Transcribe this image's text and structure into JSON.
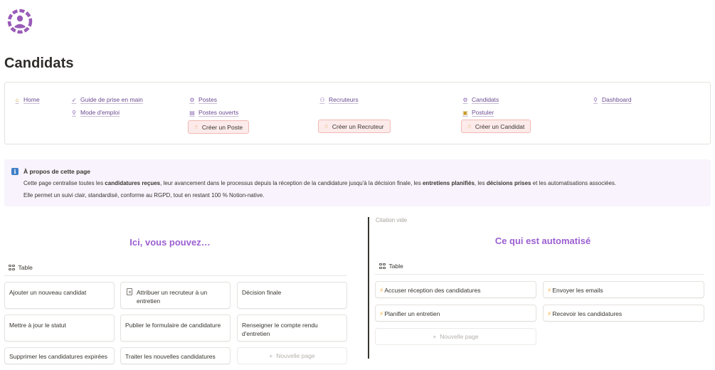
{
  "page": {
    "title": "Candidats"
  },
  "nav": {
    "home": "Home",
    "guide": "Guide de prise en main",
    "mode": "Mode d'emploi",
    "postes": "Postes",
    "postes_ouverts": "Postes ouverts",
    "creer_poste": "Créer un Poste",
    "recruteurs": "Recruteurs",
    "creer_recruteur": "Créer un Recruteur",
    "candidats": "Candidats",
    "postuler": "Postuler",
    "creer_candidat": "Créer un Candidat",
    "dashboard": "Dashboard"
  },
  "about": {
    "title": "À propos de cette page",
    "l1_a": "Cette page centralise toutes les ",
    "l1_b": "candidatures reçues",
    "l1_c": ", leur avancement dans le processus depuis la réception de la candidature jusqu'à la décision finale, les ",
    "l1_d": "entretiens planifiés",
    "l1_e": ", les ",
    "l1_f": "décisions prises",
    "l1_g": " et les automatisations associées.",
    "l2": "Elle permet un suivi clair, standardisé, conforme au RGPD, tout en restant 100 % Notion-native."
  },
  "left": {
    "heading": "Ici, vous pouvez…",
    "table_label": "Table",
    "cards": [
      "Ajouter un nouveau candidat",
      "Attribuer un recruteur à un entretien",
      "Décision finale",
      "Mettre à jour le statut",
      "Publier le formulaire de candidature",
      "Renseigner le compte rendu d'entretien",
      "Supprimer les candidatures expirées",
      "Traiter les nouvelles candidatures"
    ],
    "new_page": "Nouvelle page"
  },
  "right": {
    "citation": "Citation vide",
    "heading": "Ce qui est automatisé",
    "table_label": "Table",
    "cards": [
      "Accuser réception des candidatures",
      "Envoyer les emails",
      "Planifier un entretien",
      "Recevoir les candidatures"
    ],
    "new_page": "Nouvelle page"
  },
  "colors": {
    "accent": "#9b5fd1",
    "link": "#6b4b91",
    "info": "#3f7ec7",
    "bolt": "#f5a623"
  }
}
